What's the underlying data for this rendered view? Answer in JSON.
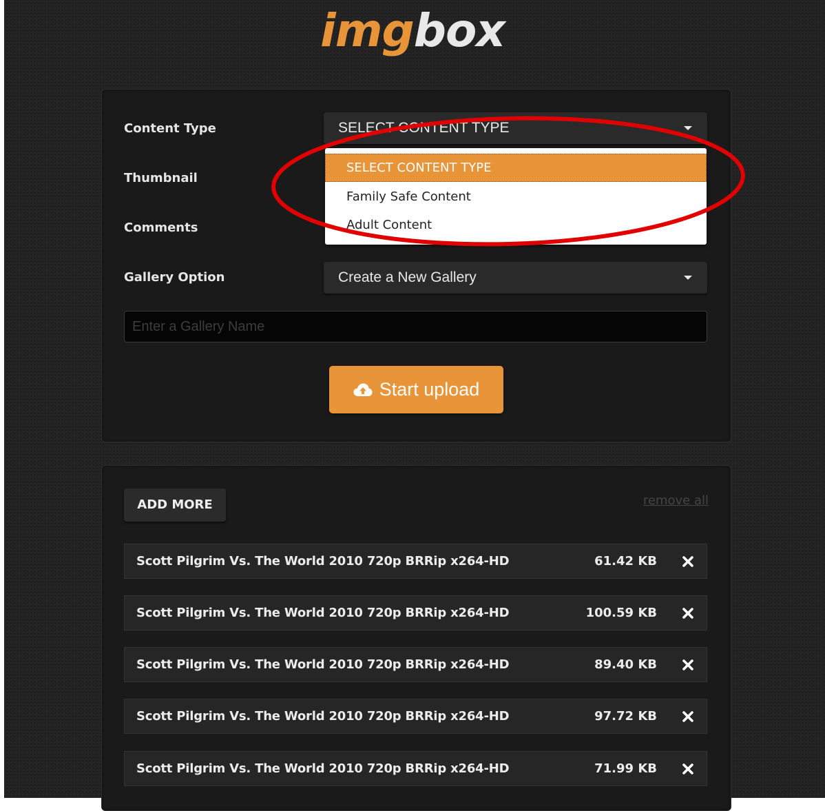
{
  "logo": {
    "part1": "img",
    "part2": "box"
  },
  "settings": {
    "content_type_label": "Content Type",
    "content_type_value": "SELECT CONTENT TYPE",
    "content_type_options": [
      "SELECT CONTENT TYPE",
      "Family Safe Content",
      "Adult Content"
    ],
    "thumbnail_label": "Thumbnail",
    "comments_label": "Comments",
    "gallery_option_label": "Gallery Option",
    "gallery_option_value": "Create a New Gallery",
    "gallery_name_placeholder": "Enter a Gallery Name",
    "start_upload_label": "Start upload"
  },
  "files": {
    "add_more_label": "ADD MORE",
    "remove_all_label": "remove all",
    "items": [
      {
        "name": "Scott Pilgrim Vs. The World 2010 720p BRRip x264-HD",
        "size": "61.42 KB"
      },
      {
        "name": "Scott Pilgrim Vs. The World 2010 720p BRRip x264-HD",
        "size": "100.59 KB"
      },
      {
        "name": "Scott Pilgrim Vs. The World 2010 720p BRRip x264-HD",
        "size": "89.40 KB"
      },
      {
        "name": "Scott Pilgrim Vs. The World 2010 720p BRRip x264-HD",
        "size": "97.72 KB"
      },
      {
        "name": "Scott Pilgrim Vs. The World 2010 720p BRRip x264-HD",
        "size": "71.99 KB"
      }
    ]
  },
  "colors": {
    "accent": "#e8953a",
    "background": "#232323",
    "panel": "#1a1a1a",
    "annotation": "#e00000"
  },
  "icons": {
    "upload": "cloud-upload-icon",
    "dropdown": "caret-down-icon",
    "remove": "close-icon"
  }
}
